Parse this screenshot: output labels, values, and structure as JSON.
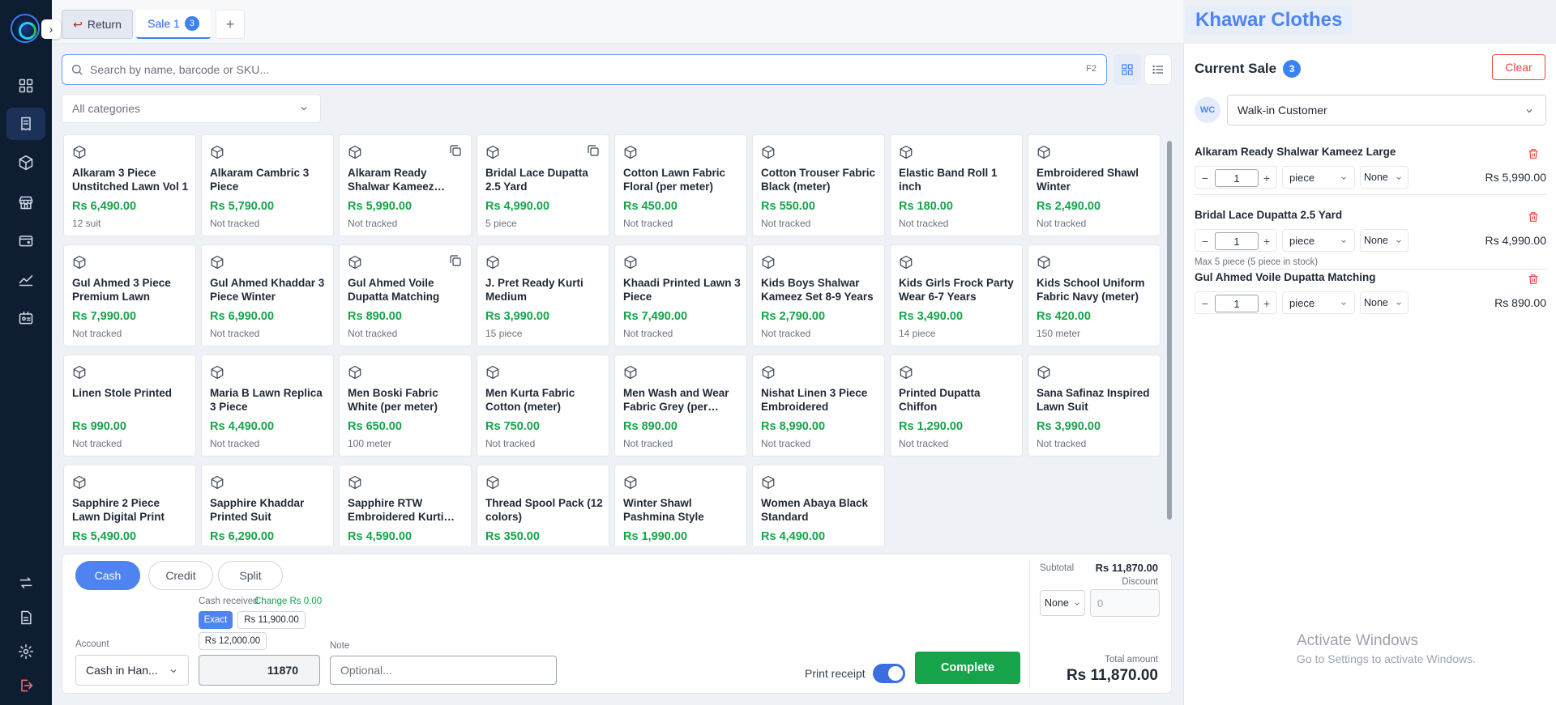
{
  "tabs": {
    "return_label": "Return",
    "sale_label": "Sale 1",
    "sale_count": "3",
    "add_label": "+"
  },
  "search": {
    "placeholder": "Search by name, barcode or SKU...",
    "shortcut": "F2"
  },
  "category": {
    "placeholder": "All categories"
  },
  "products": [
    {
      "name": "Alkaram 3 Piece Unstitched Lawn Vol 1",
      "price": "Rs 6,490.00",
      "stock": "12 suit",
      "copy": false
    },
    {
      "name": "Alkaram Cambric 3 Piece",
      "price": "Rs 5,790.00",
      "stock": "Not tracked",
      "copy": false
    },
    {
      "name": "Alkaram Ready Shalwar Kameez…",
      "price": "Rs 5,990.00",
      "stock": "Not tracked",
      "copy": true
    },
    {
      "name": "Bridal Lace Dupatta 2.5 Yard",
      "price": "Rs 4,990.00",
      "stock": "5 piece",
      "copy": true
    },
    {
      "name": "Cotton Lawn Fabric Floral (per meter)",
      "price": "Rs 450.00",
      "stock": "Not tracked",
      "copy": false
    },
    {
      "name": "Cotton Trouser Fabric Black (meter)",
      "price": "Rs 550.00",
      "stock": "Not tracked",
      "copy": false
    },
    {
      "name": "Elastic Band Roll 1 inch",
      "price": "Rs 180.00",
      "stock": "Not tracked",
      "copy": false
    },
    {
      "name": "Embroidered Shawl Winter",
      "price": "Rs 2,490.00",
      "stock": "Not tracked",
      "copy": false
    },
    {
      "name": "Gul Ahmed 3 Piece Premium Lawn",
      "price": "Rs 7,990.00",
      "stock": "Not tracked",
      "copy": false
    },
    {
      "name": "Gul Ahmed Khaddar 3 Piece Winter",
      "price": "Rs 6,990.00",
      "stock": "Not tracked",
      "copy": false
    },
    {
      "name": "Gul Ahmed Voile Dupatta Matching",
      "price": "Rs 890.00",
      "stock": "Not tracked",
      "copy": true
    },
    {
      "name": "J. Pret Ready Kurti Medium",
      "price": "Rs 3,990.00",
      "stock": "15 piece",
      "copy": false
    },
    {
      "name": "Khaadi Printed Lawn 3 Piece",
      "price": "Rs 7,490.00",
      "stock": "Not tracked",
      "copy": false
    },
    {
      "name": "Kids Boys Shalwar Kameez Set 8-9 Years",
      "price": "Rs 2,790.00",
      "stock": "Not tracked",
      "copy": false
    },
    {
      "name": "Kids Girls Frock Party Wear 6-7 Years",
      "price": "Rs 3,490.00",
      "stock": "14 piece",
      "copy": false
    },
    {
      "name": "Kids School Uniform Fabric Navy (meter)",
      "price": "Rs 420.00",
      "stock": "150 meter",
      "copy": false
    },
    {
      "name": "Linen Stole Printed",
      "price": "Rs 990.00",
      "stock": "Not tracked",
      "copy": false
    },
    {
      "name": "Maria B Lawn Replica 3 Piece",
      "price": "Rs 4,490.00",
      "stock": "Not tracked",
      "copy": false
    },
    {
      "name": "Men Boski Fabric White (per meter)",
      "price": "Rs 650.00",
      "stock": "100 meter",
      "copy": false
    },
    {
      "name": "Men Kurta Fabric Cotton (meter)",
      "price": "Rs 750.00",
      "stock": "Not tracked",
      "copy": false
    },
    {
      "name": "Men Wash and Wear Fabric Grey (per…",
      "price": "Rs 890.00",
      "stock": "Not tracked",
      "copy": false
    },
    {
      "name": "Nishat Linen 3 Piece Embroidered",
      "price": "Rs 8,990.00",
      "stock": "Not tracked",
      "copy": false
    },
    {
      "name": "Printed Dupatta Chiffon",
      "price": "Rs 1,290.00",
      "stock": "Not tracked",
      "copy": false
    },
    {
      "name": "Sana Safinaz Inspired Lawn Suit",
      "price": "Rs 3,990.00",
      "stock": "Not tracked",
      "copy": false
    },
    {
      "name": "Sapphire 2 Piece Lawn Digital Print",
      "price": "Rs 5,490.00",
      "stock": "",
      "copy": false
    },
    {
      "name": "Sapphire Khaddar Printed Suit",
      "price": "Rs 6,290.00",
      "stock": "",
      "copy": false
    },
    {
      "name": "Sapphire RTW Embroidered Kurti…",
      "price": "Rs 4,590.00",
      "stock": "",
      "copy": false
    },
    {
      "name": "Thread Spool Pack (12 colors)",
      "price": "Rs 350.00",
      "stock": "",
      "copy": false
    },
    {
      "name": "Winter Shawl Pashmina Style",
      "price": "Rs 1,990.00",
      "stock": "",
      "copy": false
    },
    {
      "name": "Women Abaya Black Standard",
      "price": "Rs 4,490.00",
      "stock": "",
      "copy": false
    }
  ],
  "payment": {
    "methods": [
      "Cash",
      "Credit",
      "Split"
    ],
    "cash_received_label": "Cash received",
    "change_label": "Change Rs 0.00",
    "exact_label": "Exact",
    "quick_amounts": [
      "Rs 11,900.00",
      "Rs 12,000.00"
    ],
    "account_label": "Account",
    "account_value": "Cash in Han...",
    "amount_value": "11870",
    "note_label": "Note",
    "note_placeholder": "Optional...",
    "print_receipt_label": "Print receipt",
    "print_receipt_on": true,
    "complete_label": "Complete",
    "subtotal_label": "Subtotal",
    "subtotal_value": "Rs 11,870.00",
    "discount_label": "Discount",
    "discount_type": "None",
    "discount_placeholder": "0",
    "total_label": "Total amount",
    "total_value": "Rs 11,870.00"
  },
  "store_name": "Khawar Clothes",
  "cart": {
    "title": "Current Sale",
    "count": "3",
    "clear_label": "Clear",
    "customer_initials": "WC",
    "customer": "Walk-in Customer",
    "items": [
      {
        "name": "Alkaram Ready Shalwar Kameez Large",
        "qty": "1",
        "unit": "piece",
        "variant": "None",
        "price": "Rs 5,990.00",
        "note": ""
      },
      {
        "name": "Bridal Lace Dupatta 2.5 Yard",
        "qty": "1",
        "unit": "piece",
        "variant": "None",
        "price": "Rs 4,990.00",
        "note": "Max 5 piece (5 piece in stock)"
      },
      {
        "name": "Gul Ahmed Voile Dupatta Matching",
        "qty": "1",
        "unit": "piece",
        "variant": "None",
        "price": "Rs 890.00",
        "note": ""
      }
    ]
  },
  "watermark": {
    "line1": "Activate Windows",
    "line2": "Go to Settings to activate Windows."
  },
  "colors": {
    "sidebar": "#0f1d33",
    "accent": "#4f83f1",
    "price_green": "#16a34a",
    "danger": "#ef4444"
  }
}
